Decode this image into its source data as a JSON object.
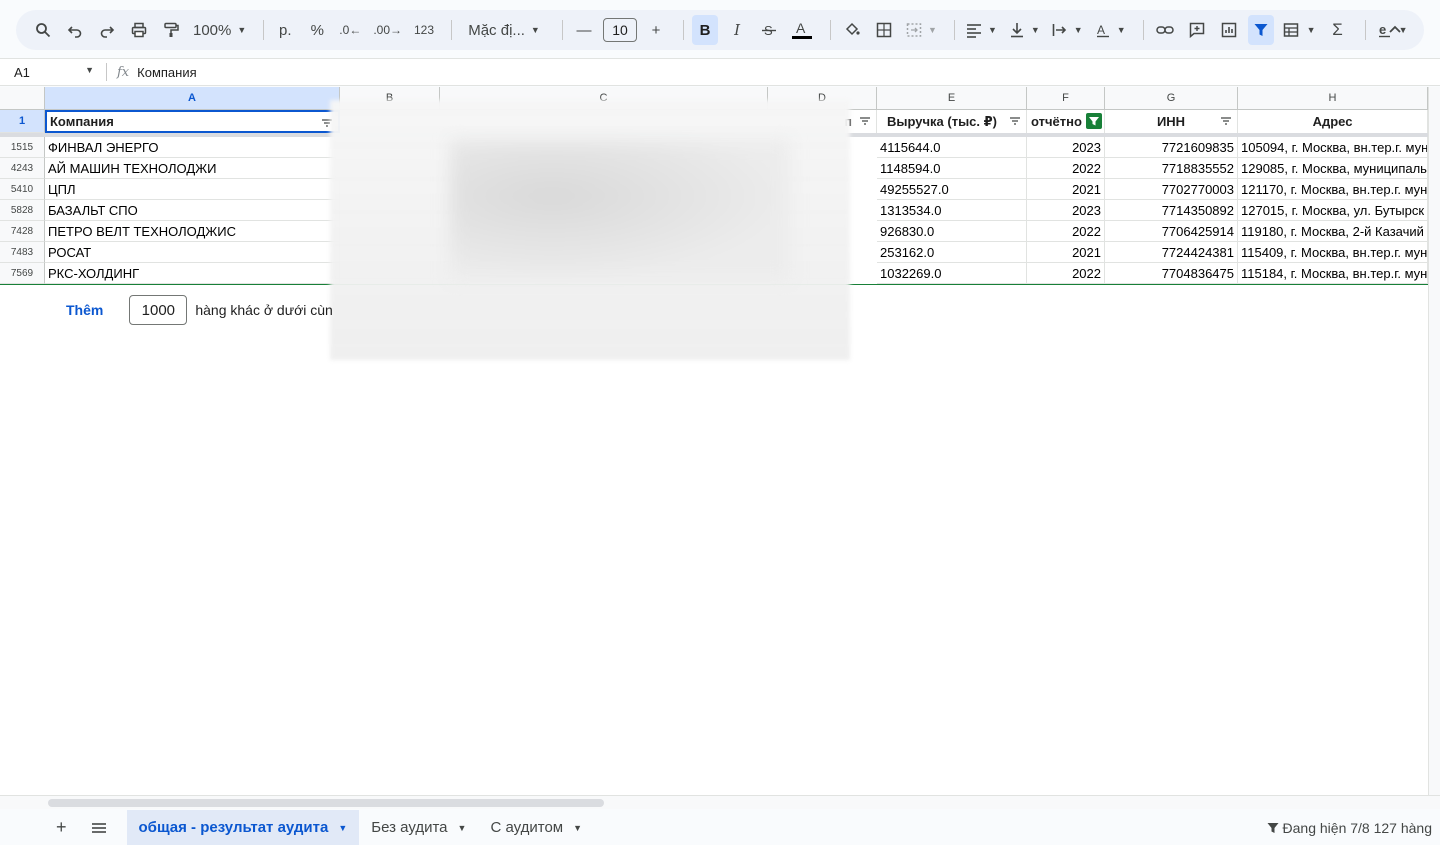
{
  "toolbar": {
    "zoom": "100%",
    "currency": "р.",
    "percent": "%",
    "dec_decrease": ".0",
    "dec_increase": ".00",
    "format_123": "123",
    "font": "Mặc đị...",
    "font_size": "10",
    "bold": "B",
    "italic": "I",
    "sigma": "Σ"
  },
  "formula_bar": {
    "cell_ref": "A1",
    "content": "Компания"
  },
  "columns": [
    "A",
    "B",
    "C",
    "D",
    "E",
    "F",
    "G",
    "H"
  ],
  "header_row": {
    "row_number": "1",
    "company": "Компания",
    "d_fragment": "п",
    "revenue": "Выручка (тыс. ₽)",
    "year_fragment": "отчётно",
    "inn": "ИНН",
    "address": "Адрес"
  },
  "rows": [
    {
      "num": "1515",
      "company": "ФИНВАЛ ЭНЕРГО",
      "revenue": "4115644.0",
      "year": "2023",
      "inn": "7721609835",
      "address": "105094, г. Москва, вн.тер.г. мун"
    },
    {
      "num": "4243",
      "company": "АЙ МАШИН ТЕХНОЛОДЖИ",
      "revenue": "1148594.0",
      "year": "2022",
      "inn": "7718835552",
      "address": "129085, г. Москва, муниципальн"
    },
    {
      "num": "5410",
      "company": "ЦПЛ",
      "revenue": "49255527.0",
      "year": "2021",
      "inn": "7702770003",
      "address": "121170, г. Москва, вн.тер.г. мун"
    },
    {
      "num": "5828",
      "company": "БАЗАЛЬТ СПО",
      "revenue": "1313534.0",
      "year": "2023",
      "inn": "7714350892",
      "address": "127015, г. Москва, ул. Бутырск"
    },
    {
      "num": "7428",
      "company": "ПЕТРО ВЕЛТ ТЕХНОЛОДЖИС",
      "revenue": "926830.0",
      "year": "2022",
      "inn": "7706425914",
      "address": "119180, г. Москва, 2-й Казачий"
    },
    {
      "num": "7483",
      "company": "РОСАТ",
      "revenue": "253162.0",
      "year": "2021",
      "inn": "7724424381",
      "address": "115409, г. Москва, вн.тер.г. мун"
    },
    {
      "num": "7569",
      "company": "РКС-ХОЛДИНГ",
      "revenue": "1032269.0",
      "year": "2022",
      "inn": "7704836475",
      "address": "115184, г. Москва, вн.тер.г. мун"
    }
  ],
  "add_rows": {
    "button": "Thêm",
    "count": "1000",
    "suffix": "hàng khác ở dưới cùn"
  },
  "sheets": [
    {
      "label": "общая - результат аудита",
      "active": true
    },
    {
      "label": "Без аудита",
      "active": false
    },
    {
      "label": "С аудитом",
      "active": false
    }
  ],
  "status": "Đang hiện 7/8 127 hàng",
  "colors": {
    "accent": "#0b57d0",
    "selection": "#d3e3fd",
    "filter_active": "#188038"
  }
}
